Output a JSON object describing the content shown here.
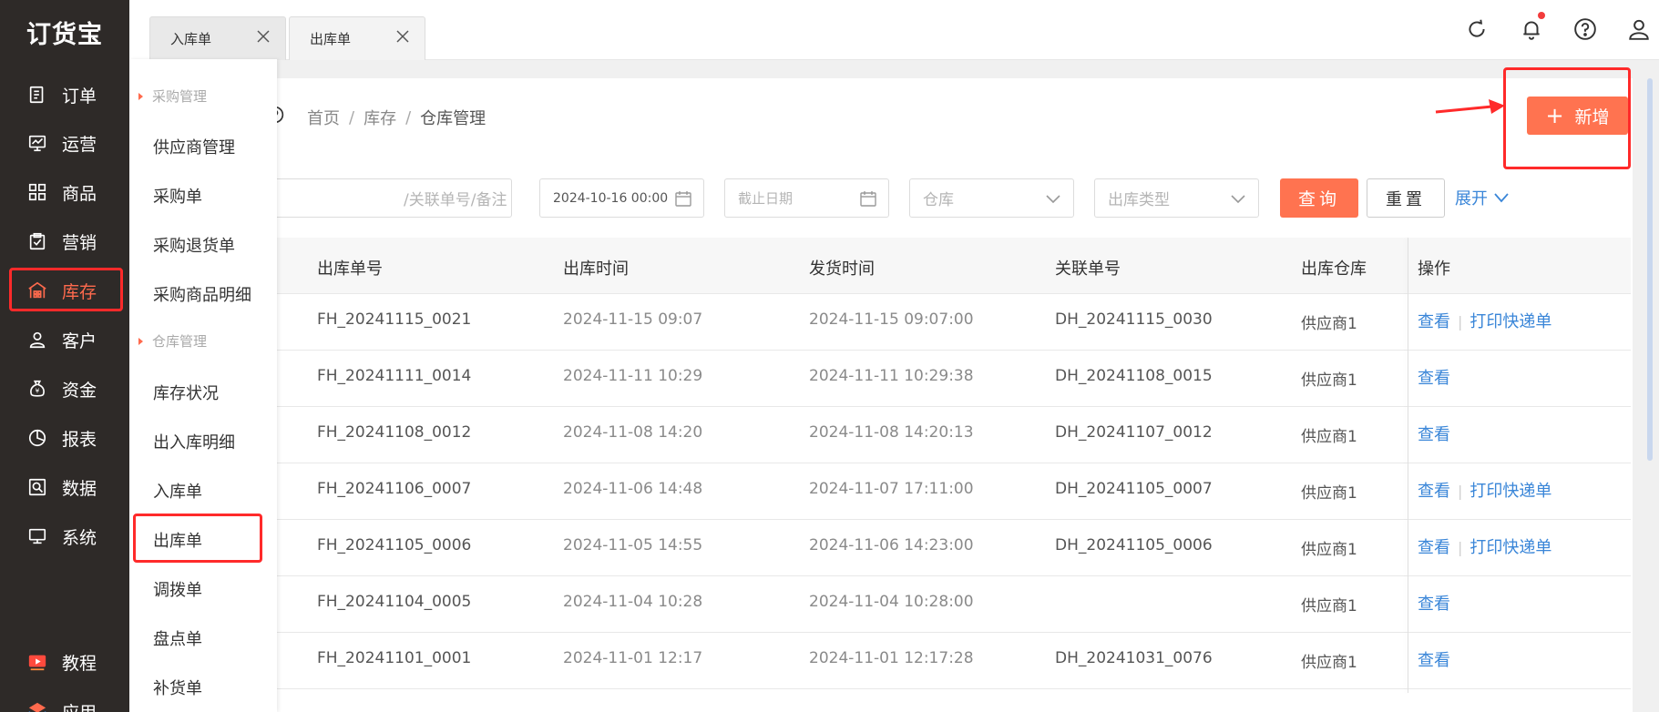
{
  "app": {
    "logo": "订货宝"
  },
  "sidebar": {
    "items": [
      {
        "label": "订单",
        "icon": "order-icon"
      },
      {
        "label": "运营",
        "icon": "operation-icon"
      },
      {
        "label": "商品",
        "icon": "goods-icon"
      },
      {
        "label": "营销",
        "icon": "marketing-icon"
      },
      {
        "label": "库存",
        "icon": "warehouse-icon",
        "active": true
      },
      {
        "label": "客户",
        "icon": "customer-icon"
      },
      {
        "label": "资金",
        "icon": "money-icon"
      },
      {
        "label": "报表",
        "icon": "report-icon"
      },
      {
        "label": "数据",
        "icon": "data-icon"
      },
      {
        "label": "系统",
        "icon": "system-icon"
      }
    ],
    "bottom": [
      {
        "label": "教程",
        "icon": "tutorial-icon"
      },
      {
        "label": "应用",
        "icon": "app-icon"
      }
    ]
  },
  "flyout": {
    "group_purchase": "采购管理",
    "purchase_items": [
      "供应商管理",
      "采购单",
      "采购退货单",
      "采购商品明细"
    ],
    "group_warehouse": "仓库管理",
    "warehouse_items": [
      "库存状况",
      "出入库明细",
      "入库单",
      "出库单",
      "调拨单",
      "盘点单",
      "补货单"
    ]
  },
  "tabs": [
    {
      "label": "入库单"
    },
    {
      "label": "出库单",
      "active": true
    }
  ],
  "breadcrumb": {
    "home": "首页",
    "level1": "库存",
    "current": "仓库管理",
    "sep": "/"
  },
  "filters": {
    "search_placeholder": "/关联单号/备注",
    "date_start": "2024-10-16 00:00",
    "date_end_placeholder": "截止日期",
    "warehouse_placeholder": "仓库",
    "type_placeholder": "出库类型",
    "query_label": "查询",
    "reset_label": "重置",
    "expand_label": "展开"
  },
  "add_button": {
    "label": "新增"
  },
  "table": {
    "columns": [
      "出库单号",
      "出库时间",
      "发货时间",
      "关联单号",
      "出库仓库",
      "操作"
    ],
    "rows": [
      {
        "no": "FH_20241115_0021",
        "out_time": "2024-11-15 09:07",
        "ship_time": "2024-11-15 09:07:00",
        "ref": "DH_20241115_0030",
        "warehouse": "供应商1",
        "view": "查看",
        "print": "打印快递单"
      },
      {
        "no": "FH_20241111_0014",
        "out_time": "2024-11-11 10:29",
        "ship_time": "2024-11-11 10:29:38",
        "ref": "DH_20241108_0015",
        "warehouse": "供应商1",
        "view": "查看",
        "print": ""
      },
      {
        "no": "FH_20241108_0012",
        "out_time": "2024-11-08 14:20",
        "ship_time": "2024-11-08 14:20:13",
        "ref": "DH_20241107_0012",
        "warehouse": "供应商1",
        "view": "查看",
        "print": ""
      },
      {
        "no": "FH_20241106_0007",
        "out_time": "2024-11-06 14:48",
        "ship_time": "2024-11-07 17:11:00",
        "ref": "DH_20241105_0007",
        "warehouse": "供应商1",
        "view": "查看",
        "print": "打印快递单"
      },
      {
        "no": "FH_20241105_0006",
        "out_time": "2024-11-05 14:55",
        "ship_time": "2024-11-06 14:23:00",
        "ref": "DH_20241105_0006",
        "warehouse": "供应商1",
        "view": "查看",
        "print": "打印快递单"
      },
      {
        "no": "FH_20241104_0005",
        "out_time": "2024-11-04 10:28",
        "ship_time": "2024-11-04 10:28:00",
        "ref": "",
        "warehouse": "供应商1",
        "view": "查看",
        "print": ""
      },
      {
        "no": "FH_20241101_0001",
        "out_time": "2024-11-01 12:17",
        "ship_time": "2024-11-01 12:17:28",
        "ref": "DH_20241031_0076",
        "warehouse": "供应商1",
        "view": "查看",
        "print": ""
      }
    ]
  },
  "colors": {
    "accent": "#ff7350",
    "link": "#3a86d8",
    "sidebar_bg": "#2e2a28",
    "annotation": "#ff2a2a"
  }
}
